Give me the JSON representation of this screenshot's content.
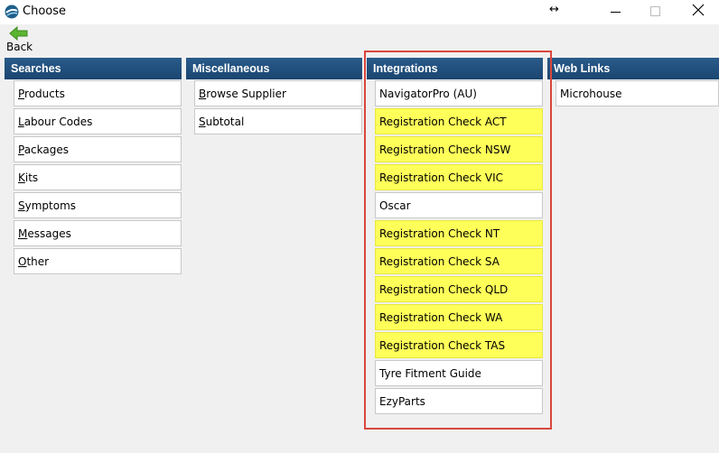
{
  "window": {
    "title": "Choose",
    "resize_glyph": "↔",
    "close_glyph": "close-icon"
  },
  "toolbar": {
    "back_label": "Back"
  },
  "columns": {
    "searches": {
      "header": "Searches",
      "items": [
        {
          "first": "P",
          "rest": "roducts"
        },
        {
          "first": "L",
          "rest": "abour Codes"
        },
        {
          "first": "P",
          "rest": "ackages"
        },
        {
          "first": "K",
          "rest": "its"
        },
        {
          "first": "S",
          "rest": "ymptoms"
        },
        {
          "first": "M",
          "rest": "essages"
        },
        {
          "first": "O",
          "rest": "ther"
        }
      ]
    },
    "miscellaneous": {
      "header": "Miscellaneous",
      "items": [
        {
          "first": "B",
          "rest": "rowse Supplier"
        },
        {
          "first": "S",
          "rest": "ubtotal"
        }
      ]
    },
    "integrations": {
      "header": "Integrations",
      "items": [
        {
          "label": "NavigatorPro (AU)",
          "highlighted": false
        },
        {
          "label": "Registration Check ACT",
          "highlighted": true
        },
        {
          "label": "Registration Check NSW",
          "highlighted": true
        },
        {
          "label": "Registration Check VIC",
          "highlighted": true
        },
        {
          "label": "Oscar",
          "highlighted": false
        },
        {
          "label": "Registration Check NT",
          "highlighted": true
        },
        {
          "label": "Registration Check SA",
          "highlighted": true
        },
        {
          "label": "Registration Check QLD",
          "highlighted": true
        },
        {
          "label": "Registration Check WA",
          "highlighted": true
        },
        {
          "label": "Registration Check TAS",
          "highlighted": true
        },
        {
          "label": "Tyre Fitment Guide",
          "highlighted": false
        },
        {
          "label": "EzyParts",
          "highlighted": false
        }
      ]
    },
    "weblinks": {
      "header": "Web Links",
      "items": [
        {
          "label": "Microhouse"
        }
      ]
    }
  },
  "colors": {
    "header_bg": "#1f4e79",
    "highlight": "#ffff5a",
    "annotation_frame": "#d9463d",
    "back_arrow": "#5cb531"
  }
}
